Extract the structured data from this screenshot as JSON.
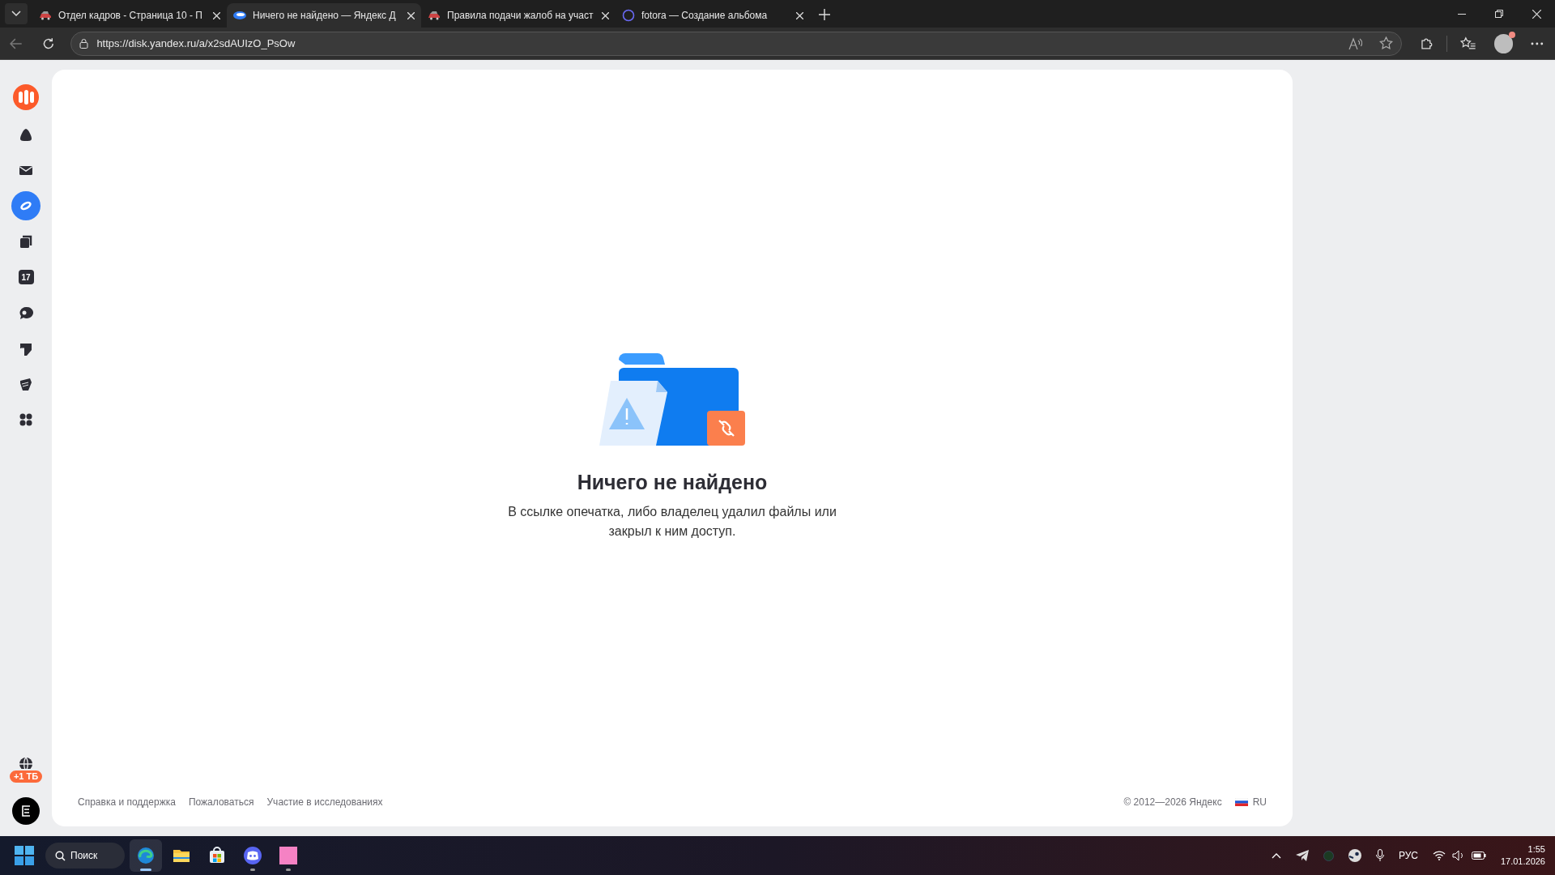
{
  "browser": {
    "tabs": [
      {
        "title": "Отдел кадров - Страница 10 - П",
        "selected": false,
        "kind": "game"
      },
      {
        "title": "Ничего не найдено — Яндекс Д",
        "selected": true,
        "kind": "disk"
      },
      {
        "title": "Правила подачи жалоб на участ",
        "selected": false,
        "kind": "game"
      },
      {
        "title": "fotora — Создание альбома",
        "selected": false,
        "kind": "ring"
      }
    ],
    "address": "https://disk.yandex.ru/a/x2sdAUIzO_PsOw"
  },
  "sidebar": {
    "items": [
      {
        "selected": false
      },
      {
        "selected": false
      },
      {
        "selected": true
      },
      {
        "selected": false
      },
      {
        "selected": false
      },
      {
        "selected": false
      },
      {
        "selected": false
      },
      {
        "selected": false
      },
      {
        "selected": false
      }
    ],
    "calendar_day": "17",
    "storage_badge": "+1 ТБ"
  },
  "empty_state": {
    "title": "Ничего не найдено",
    "message": "В ссылке опечатка, либо владелец удалил файлы или закрыл к ним доступ."
  },
  "footer": {
    "links": [
      "Справка и поддержка",
      "Пожаловаться",
      "Участие в исследованиях"
    ],
    "copyright": "© 2012—2026 Яндекс",
    "language": "RU"
  },
  "taskbar": {
    "search": "Поиск",
    "apps": [
      {
        "kind": "edge",
        "running": true,
        "selected": true
      },
      {
        "kind": "explorer",
        "running": false,
        "selected": false
      },
      {
        "kind": "store",
        "running": false,
        "selected": false
      },
      {
        "kind": "discord",
        "running": true,
        "selected": false
      },
      {
        "kind": "pink",
        "running": true,
        "selected": false
      }
    ],
    "language": "РУС",
    "time": "1:55",
    "date": "17.01.2026"
  }
}
